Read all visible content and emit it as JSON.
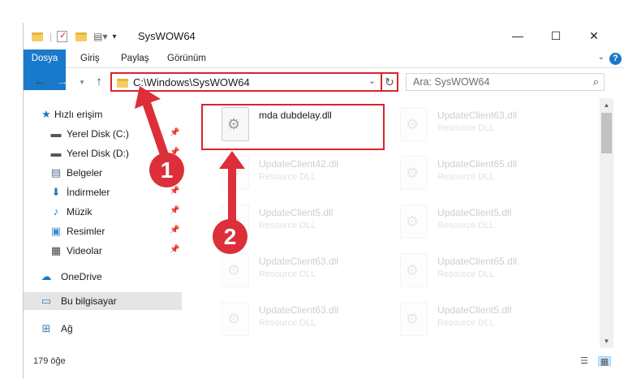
{
  "window": {
    "title": "SysWOW64"
  },
  "controls": {
    "minimize": "—",
    "maximize": "☐",
    "close": "✕"
  },
  "ribbon": {
    "tabs": [
      "Dosya",
      "Giriş",
      "Paylaş",
      "Görünüm"
    ],
    "help": "?"
  },
  "nav": {
    "address": "C:\\Windows\\SysWOW64",
    "search_placeholder": "Ara: SysWOW64"
  },
  "sidebar": {
    "items": [
      {
        "label": "Hızlı erişim"
      },
      {
        "label": "Yerel Disk (C:)"
      },
      {
        "label": "Yerel Disk (D:)"
      },
      {
        "label": "Belgeler"
      },
      {
        "label": "İndirmeler"
      },
      {
        "label": "Müzik"
      },
      {
        "label": "Resimler"
      },
      {
        "label": "Videolar"
      },
      {
        "label": "OneDrive"
      },
      {
        "label": "Bu bilgisayar"
      },
      {
        "label": "Ağ"
      }
    ]
  },
  "files": [
    {
      "name": "mda dubdelay.dll",
      "type": ""
    },
    {
      "name": "UpdateClient63.dll",
      "type": "Resource DLL"
    },
    {
      "name": "UpdateClient42.dll",
      "type": "Resource DLL"
    },
    {
      "name": "UpdateClient65.dll",
      "type": "Resource DLL"
    },
    {
      "name": "UpdateClient5.dll",
      "type": "Resource DLL"
    },
    {
      "name": "UpdateClient5.dll",
      "type": "Resource DLL"
    },
    {
      "name": "UpdateClient63.dll",
      "type": "Resource DLL"
    },
    {
      "name": "UpdateClient65.dll",
      "type": "Resource DLL"
    },
    {
      "name": "UpdateClient63.dll",
      "type": "Resource DLL"
    },
    {
      "name": "UpdateClient5.dll",
      "type": "Resource DLL"
    }
  ],
  "status": {
    "item_count": "179 öğe"
  },
  "annotations": {
    "step1": "1",
    "step2": "2"
  },
  "colors": {
    "accent": "#1979ca",
    "highlight": "#d9232d"
  }
}
